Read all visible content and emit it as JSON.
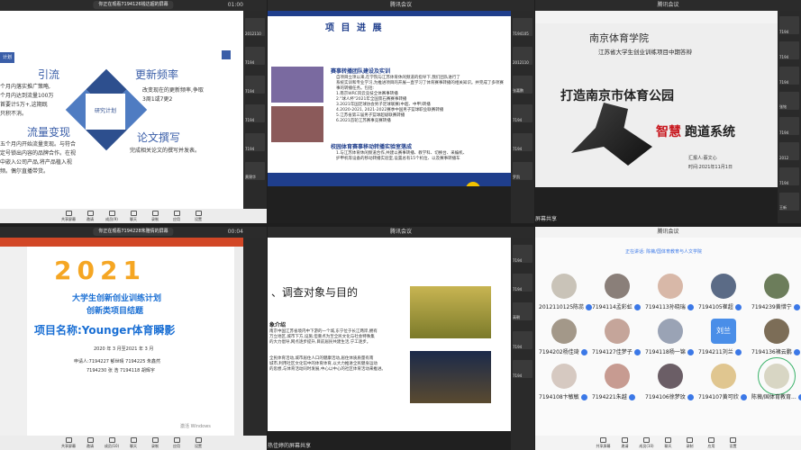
{
  "cell1": {
    "pill": "你正在观看7194126钱达超的屏幕",
    "time": "01:00",
    "slide": {
      "tag": "计划",
      "left_texts": [
        "引流",
        "流量变现"
      ],
      "left_desc1": "个月内落实推广策略,\n个月内达到流量100万\n首要计5万+,这期既\n只积不消。",
      "left_desc2": "五个月内开始流量变现。与符合\n定号锁出内容的品牌合作。在视\n中嵌入公司产品,将产品植入视\n频。偶尔直播带货。",
      "right_titles": [
        "更新频率",
        "论文撰写"
      ],
      "right_desc1": "改变现在的更新频率,争取\n3周1或7更2",
      "right_desc2": "完成相关论文的撰写并发表。",
      "center": "研究计划"
    },
    "thumbs": [
      "2012110",
      "7194",
      "7194",
      "7194",
      "7194",
      "黄锦华"
    ],
    "toolbar": [
      "共享屏幕",
      "邀请",
      "成员(9)",
      "聊天",
      "录制",
      "应用",
      "设置"
    ]
  },
  "cell2": {
    "title": "腾讯会议",
    "slide": {
      "heading": "项 目 进 展",
      "sec1": "赛事转播团队建设及实训",
      "sec1_body": "自项目立项以来,在学院与江苏体育休闲频道的指导下,我们团队进行了\n系统实训和专业学习,为推进项目的开展一直学习了体育赛事转播的相关知识。并完成了多项赛事的转播任务。包括:\n1.南京WRC风云竞技全体赛事转播\n2.\"球人杯\"2021年全国景石赛赛事转播\n3.2021年国足球协会男子足球联赛(中超、中甲)转播\n4.2020-2021, 2021-2022赛季中国男子篮球职业联赛转播\n5.江苏省第三届男子篮球超级联赛转播\n6.2021首轮江苏赛事竞赛转播",
      "sec2": "校园体育赛事移动转播实验室落成",
      "sec2_body": "1.与江苏体育休闲频道合作,共建以赛事转播、教学科、切换台、采编机、\n护甲机等设备的移动转播实验室,设置总有15个机位、以及赛事转播车"
    },
    "thumbs": [
      "7194105",
      "2012110",
      "张嘉鹏",
      "7194",
      "7194",
      "罗凯"
    ]
  },
  "cell3": {
    "title": "腾讯会议",
    "slide": {
      "school": "南京体育学院",
      "subtitle": "江苏省大学生创业训练项目中期答辩",
      "title1": "打造南京市体育公园",
      "title2": "智慧",
      "title3": "跑道系统",
      "reporter": "汇报人:蔡文心",
      "date": "时间:2021年11月1日"
    },
    "footer": "屏幕共享",
    "thumbs": [
      "7194",
      "7194",
      "7194",
      "张铭",
      "7194",
      "2012",
      "7194",
      "王新"
    ]
  },
  "cell4": {
    "pill": "你正在观看7194228朱雅倩的屏幕",
    "time": "00:04",
    "slide": {
      "year": "2021",
      "line1": "大学生创新创业训练计划",
      "line2": "创新类项目结题",
      "project": "项目名称:Younger体育瞬影",
      "date": "2020 年 3 月至2021 年 3 月",
      "members1": "申请人:7194227 郁世晴    7194225 朱鑫然",
      "members2": "7194230 张 浩    7194118 胡辉宇",
      "watermark": "激活 Windows"
    },
    "toolbar": [
      "共享屏幕",
      "邀请",
      "成员(10)",
      "聊天",
      "录制",
      "应用",
      "设置"
    ]
  },
  "cell5": {
    "title": "腾讯会议",
    "slide": {
      "heading": "、调查对象与目的",
      "para_head": "象介绍",
      "para1": "南京中国江苏省境内中下游的一个城,东宁位于长江两岸,拥有\n万立地区,城市下方,设施,但重点为至全民文化与社会特殊集\n的大力倡导,网点逐步提升,目前居民共建生活,宁工逐步。",
      "para2": "全民体育活动,城市居住人口的健康活动,居住体质质量有南\n城市,利用社区文化馆中的体育体育,以大力推进全民健身运动\n的思想,与体育活动同时发展,中心以中心的社区体育活动来推进。",
      "footer": "热佳婷的屏幕共享"
    },
    "thumbs": [
      "7194",
      "7194",
      "高朝",
      "7194",
      "7194"
    ]
  },
  "cell6": {
    "title": "腾讯会议",
    "speaking": "正在讲话: 陈薇/国体育教育与人文学院",
    "members": [
      {
        "name": "2012110125陈蕊",
        "color": "#c9c3b8"
      },
      {
        "name": "7194114孟彩虹",
        "color": "#8a7f79"
      },
      {
        "name": "7194113孙晓瑞",
        "color": "#d8b8a8"
      },
      {
        "name": "7194105崔超",
        "color": "#5b6b86"
      },
      {
        "name": "7194239黄惜宁",
        "color": "#6c7d5b"
      },
      {
        "name": "7194202杨佳琦",
        "color": "#a39889"
      },
      {
        "name": "7194127佳梦子",
        "color": "#c5a59a"
      },
      {
        "name": "7194118杨一锦",
        "color": "#9aa3b5"
      },
      {
        "name": "7194211刘兰",
        "color": "#4a8ee8"
      },
      {
        "name": "7194136褚云鹏",
        "color": "#7c6d57"
      },
      {
        "name": "7194108卞敏敏",
        "color": "#d6c9c1"
      },
      {
        "name": "7194221朱越",
        "color": "#c79b91"
      },
      {
        "name": "7194106徐梦玟",
        "color": "#6b5e66"
      },
      {
        "name": "7194107黄可欣",
        "color": "#e0c690"
      },
      {
        "name": "陈薇/国体育教育...",
        "color": "#d8d6c4"
      }
    ],
    "avatar_text": "刘兰",
    "toolbar": [
      "共享屏幕",
      "邀请",
      "成员(10)",
      "聊天",
      "录制",
      "应用",
      "设置"
    ]
  }
}
